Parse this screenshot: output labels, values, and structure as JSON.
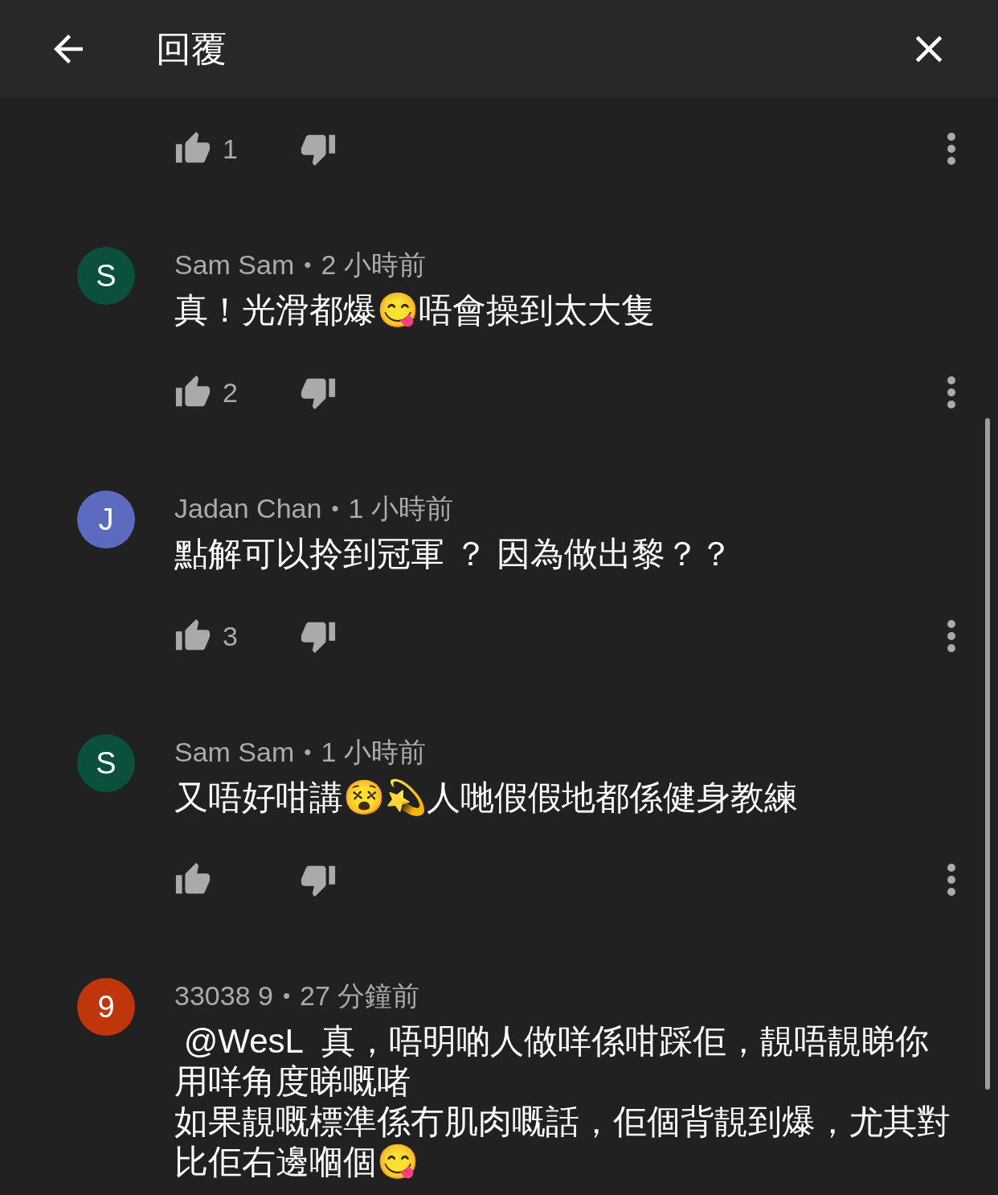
{
  "header": {
    "title": "回覆"
  },
  "comments": [
    {
      "likes": "1"
    },
    {
      "author": "Sam Sam",
      "separator": "•",
      "time": "2 小時前",
      "initial": "S",
      "color": "#0b4f3f",
      "paragraphs": [
        "真！光滑都爆😋唔會操到太大隻"
      ],
      "likes": "2"
    },
    {
      "author": "Jadan Chan",
      "separator": "•",
      "time": "1 小時前",
      "initial": "J",
      "color": "#5c6bc0",
      "paragraphs": [
        "點解可以拎到冠軍 ？ 因為做出黎？？"
      ],
      "likes": "3"
    },
    {
      "author": "Sam Sam",
      "separator": "•",
      "time": "1 小時前",
      "initial": "S",
      "color": "#0b4f3f",
      "paragraphs": [
        "又唔好咁講😵💫人哋假假地都係健身教練"
      ]
    },
    {
      "author": "33038 9",
      "separator": "•",
      "time": "27 分鐘前",
      "initial": "9",
      "color": "#bf360c",
      "paragraphs": [
        " @WesL  真，唔明啲人做咩係咁踩佢，靚唔靚睇你用咩角度睇嘅啫",
        "如果靚嘅標準係冇肌肉嘅話，佢個背靚到爆，尤其對比佢右邊嗰個😋"
      ]
    }
  ]
}
